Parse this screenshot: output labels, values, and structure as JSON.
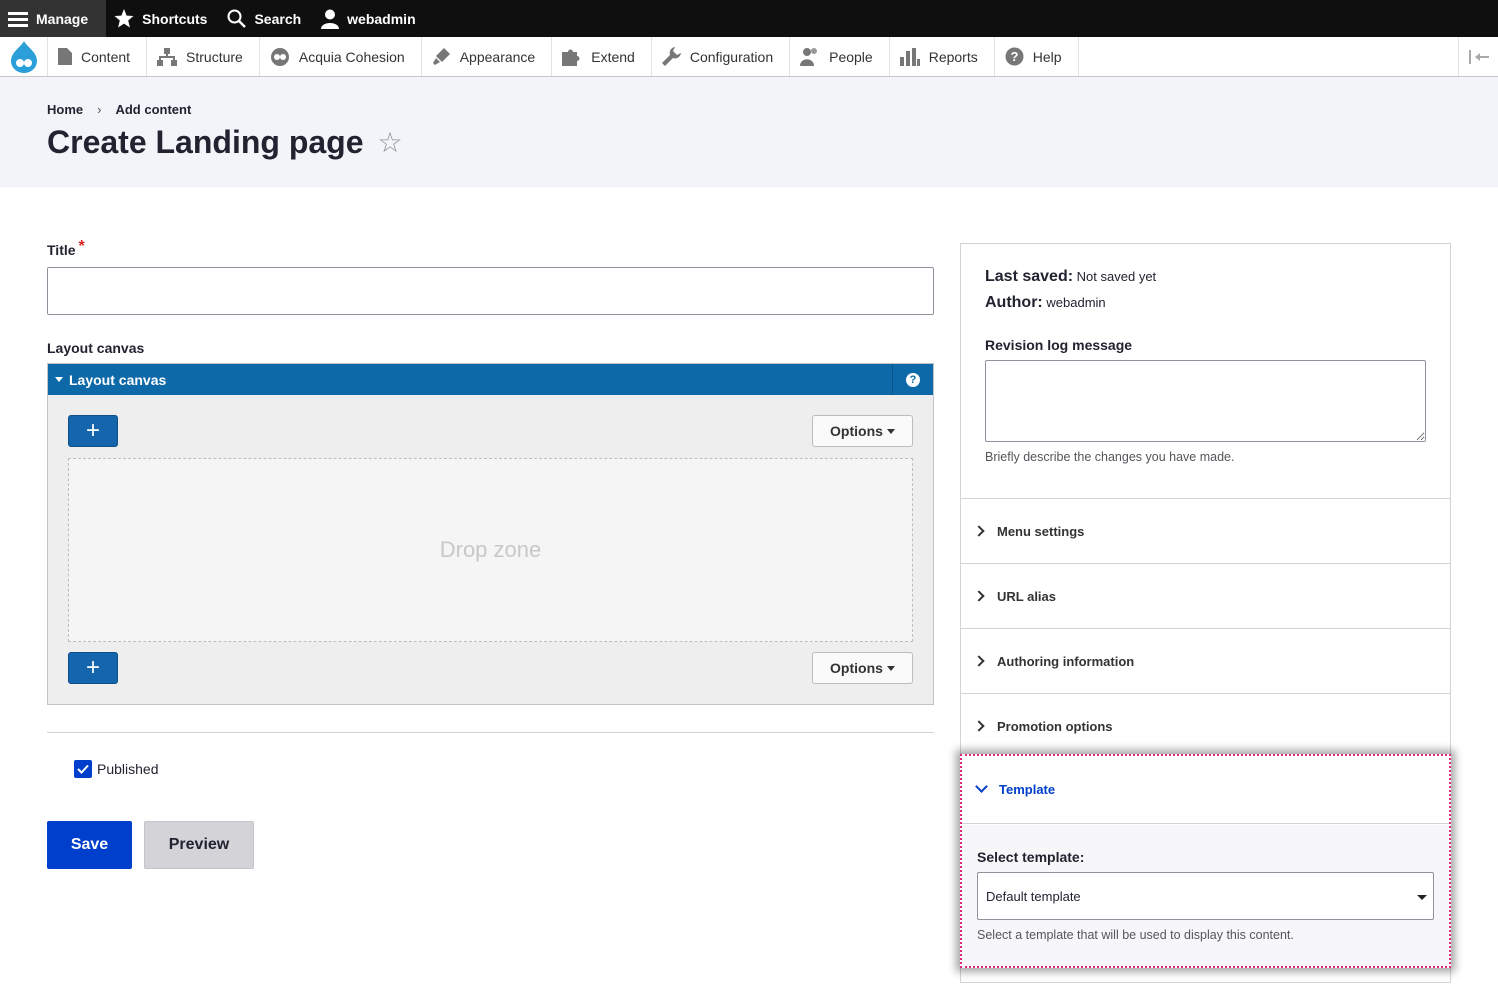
{
  "toolbar": {
    "manage": "Manage",
    "shortcuts": "Shortcuts",
    "search": "Search",
    "user": "webadmin"
  },
  "tray": {
    "items": [
      "Content",
      "Structure",
      "Acquia Cohesion",
      "Appearance",
      "Extend",
      "Configuration",
      "People",
      "Reports",
      "Help"
    ]
  },
  "breadcrumb": {
    "home": "Home",
    "separator": "›",
    "current": "Add content"
  },
  "page": {
    "title": "Create Landing page",
    "star": "☆"
  },
  "form": {
    "title_label": "Title",
    "required_mark": "*",
    "title_value": "",
    "layout_canvas_label": "Layout canvas",
    "canvas_header": "Layout canvas",
    "help_glyph": "?",
    "add_glyph": "+",
    "options_label": "Options",
    "drop_zone": "Drop zone",
    "published_label": "Published",
    "published_checked": true,
    "save_label": "Save",
    "preview_label": "Preview"
  },
  "sidebar": {
    "last_saved_label": "Last saved:",
    "last_saved_value": "Not saved yet",
    "author_label": "Author:",
    "author_value": "webadmin",
    "revision_label": "Revision log message",
    "revision_value": "",
    "revision_help": "Briefly describe the changes you have made.",
    "sections": [
      "Menu settings",
      "URL alias",
      "Authoring information",
      "Promotion options"
    ],
    "template": {
      "title": "Template",
      "select_label": "Select template:",
      "selected": "Default template",
      "help": "Select a template that will be used to display this content."
    }
  },
  "colors": {
    "toolbar_bg": "#0f0f0f",
    "canvas_header": "#0e69a8",
    "primary": "#003ecc",
    "highlight_border": "#e0267d",
    "header_bg": "#f3f4f9"
  }
}
